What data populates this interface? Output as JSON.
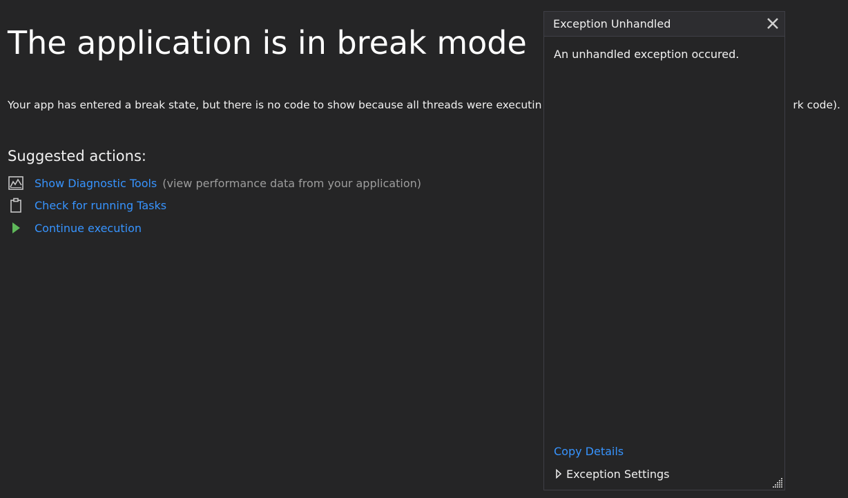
{
  "main": {
    "title": "The application is in break mode",
    "description_start": "Your app has entered a break state, but there is no code to show because all threads were executin",
    "description_end": "rk code).",
    "suggested_heading": "Suggested actions:",
    "actions": [
      {
        "icon": "diagnostic-chart-icon",
        "label": "Show Diagnostic Tools",
        "hint": "(view performance data from your application)"
      },
      {
        "icon": "clipboard-icon",
        "label": "Check for running Tasks"
      },
      {
        "icon": "play-icon",
        "label": "Continue execution"
      }
    ]
  },
  "popup": {
    "title": "Exception Unhandled",
    "message": "An unhandled exception occured.",
    "copy_details": "Copy Details",
    "exception_settings": "Exception Settings"
  },
  "colors": {
    "background": "#252526",
    "link": "#3794ff",
    "hint": "#9d9d9d",
    "play": "#5fb85a",
    "popup_header": "#2d2d30",
    "border": "#3f3f46"
  }
}
